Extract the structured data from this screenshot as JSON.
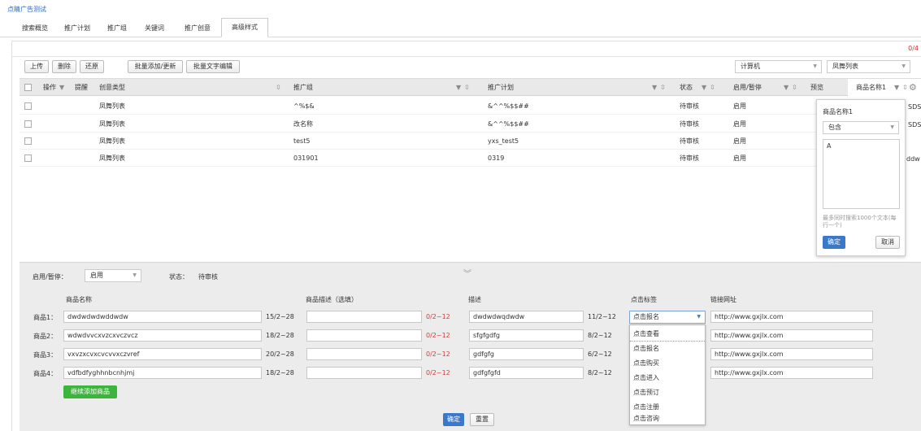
{
  "breadcrumb": "点睛广告测试",
  "tabs": [
    {
      "label": "搜索概览"
    },
    {
      "label": "推广计划"
    },
    {
      "label": "推广组"
    },
    {
      "label": "关键词"
    },
    {
      "label": "推广创意"
    },
    {
      "label": "高级样式",
      "active": true
    }
  ],
  "counter": "0/4",
  "toolbar": {
    "upload": "上传",
    "delete": "删除",
    "restore": "还原",
    "batch_add": "批量添加/更新",
    "batch_text": "批量文字编辑",
    "device": "计算机",
    "view_type": "凤舞列表"
  },
  "table": {
    "headers": {
      "action": "操作",
      "remind": "提醒",
      "creative_type": "创意类型",
      "group": "推广组",
      "plan": "推广计划",
      "status": "状态",
      "enable": "启用/暂停",
      "preview": "预览",
      "product_name": "商品名称1"
    },
    "rows": [
      {
        "creative_type": "凤舞列表",
        "group": "^%$&",
        "plan": "&^^%$$##",
        "status": "待审核",
        "enable": "启用",
        "extra": "SDS"
      },
      {
        "creative_type": "凤舞列表",
        "group": "改名称",
        "plan": "&^^%$$##",
        "status": "待审核",
        "enable": "启用",
        "extra": "SDS"
      },
      {
        "creative_type": "凤舞列表",
        "group": "test5",
        "plan": "yxs_test5",
        "status": "待审核",
        "enable": "启用",
        "extra": ""
      },
      {
        "creative_type": "凤舞列表",
        "group": "031901",
        "plan": "0319",
        "status": "待审核",
        "enable": "启用",
        "extra": "ddw"
      }
    ]
  },
  "filter_popup": {
    "title": "商品名称1",
    "mode": "包含",
    "text": "A",
    "hint": "最多同时搜索1000个文本(每行一个)",
    "ok": "确定",
    "cancel": "取消"
  },
  "editor": {
    "enable_label": "启用/暂停：",
    "enable_value": "启用",
    "status_label": "状态：",
    "status_value": "待审核",
    "col_name": "商品名称",
    "col_desc_opt": "商品描述（选填）",
    "col_desc": "描述",
    "col_tag": "点击标签",
    "col_url": "链接网址",
    "products": [
      {
        "label": "商品1：",
        "name": "dwdwdwdwddwdw",
        "name_count": "15/2~28",
        "desc_opt": "",
        "desc_opt_count": "0/2~12",
        "desc": "dwdwdwqdwdw",
        "desc_count": "11/2~12",
        "tag": "点击报名",
        "url": "http://www.gxjlx.com"
      },
      {
        "label": "商品2：",
        "name": "wdwdvvcxvzcxvczvcz",
        "name_count": "18/2~28",
        "desc_opt": "",
        "desc_opt_count": "0/2~12",
        "desc": "sfgfgdfg",
        "desc_count": "8/2~12",
        "tag": "",
        "url": "http://www.gxjlx.com"
      },
      {
        "label": "商品3：",
        "name": "vxvzxcvxcvcvvxczvref",
        "name_count": "20/2~28",
        "desc_opt": "",
        "desc_opt_count": "0/2~12",
        "desc": "gdfgfg",
        "desc_count": "6/2~12",
        "tag": "",
        "url": "http://www.gxjlx.com"
      },
      {
        "label": "商品4：",
        "name": "vdfbdfyghhnbcnhjmj",
        "name_count": "18/2~28",
        "desc_opt": "",
        "desc_opt_count": "0/2~12",
        "desc": "gdfgfgfd",
        "desc_count": "8/2~12",
        "tag": "",
        "url": "http://www.gxjlx.com"
      }
    ],
    "add_product": "继续添加商品",
    "confirm": "确定",
    "reset": "重置"
  },
  "tag_options": [
    "点击查看",
    "点击报名",
    "点击购买",
    "点击进入",
    "点击预订",
    "点击注册",
    "点击咨询"
  ],
  "colors": {
    "accent": "#3a78c9",
    "green": "#3db53d",
    "red": "#d23c3c"
  }
}
